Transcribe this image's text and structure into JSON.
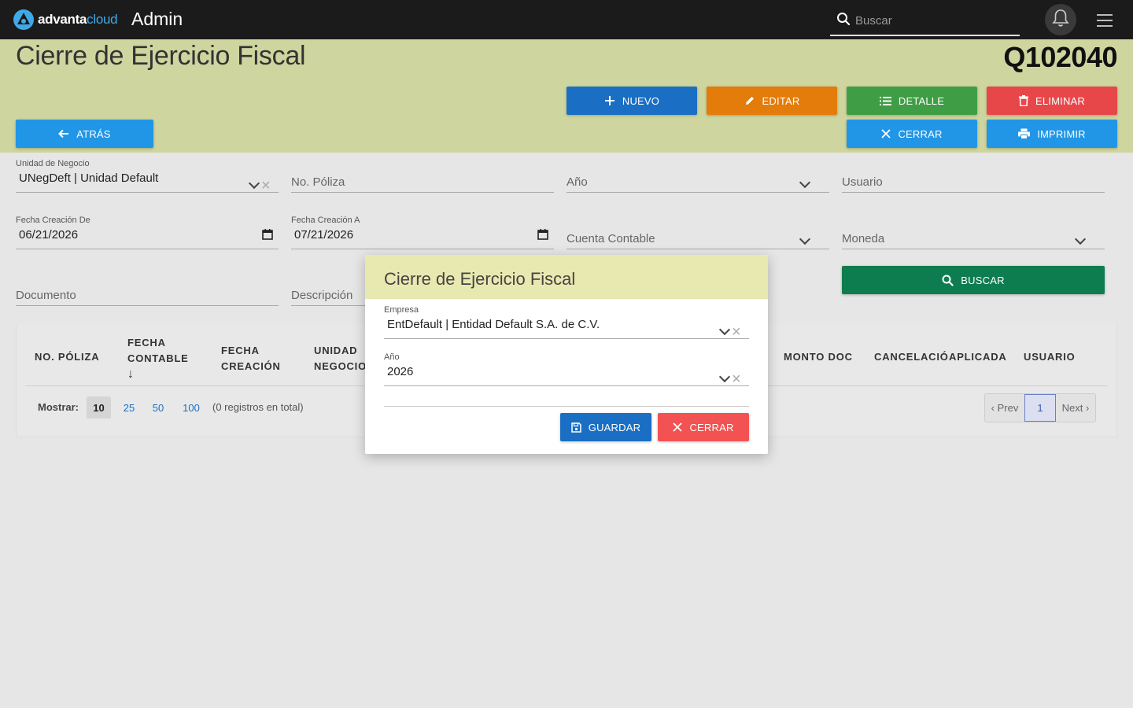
{
  "topbar": {
    "logo_brand": "advanta",
    "logo_suffix": "cloud",
    "section": "Admin",
    "search_placeholder": "Buscar",
    "icons": [
      "logo-icon",
      "search-icon",
      "bell-icon",
      "hamburger-icon"
    ]
  },
  "header": {
    "title": "Cierre de Ejercicio Fiscal",
    "code": "Q102040",
    "buttons": {
      "nuevo": "Nuevo",
      "editar": "Editar",
      "detalle": "Detalle",
      "eliminar": "Eliminar",
      "atras": "Atrás",
      "cerrar": "Cerrar",
      "imprimir": "Imprimir"
    }
  },
  "filters": {
    "unidad_label": "Unidad de Negocio",
    "unidad_value": "UNegDeft | Unidad Default",
    "poliza_placeholder": "No. Póliza",
    "anio_placeholder": "Año",
    "usuario_placeholder": "Usuario",
    "fecha_de_label": "Fecha Creación De",
    "fecha_de_value": "06/21/2026",
    "fecha_a_label": "Fecha Creación A",
    "fecha_a_value": "07/21/2026",
    "cuenta_placeholder": "Cuenta Contable",
    "moneda_placeholder": "Moneda",
    "documento_placeholder": "Documento",
    "descripcion_placeholder": "Descripción",
    "buscar_label": "Buscar"
  },
  "table": {
    "headers": {
      "poliza": "No. Póliza",
      "fecha_contable_1": "Fecha",
      "fecha_contable_2": "Contable",
      "sort_arrow": "↓",
      "fecha_creacion_1": "Fecha",
      "fecha_creacion_2": "Creación",
      "unidad_1": "Unidad",
      "unidad_2": "Negocio",
      "monto": "Monto Doc",
      "cancelacion": "Cancelació",
      "aplicada": "Aplicada",
      "usuario": "Usuario"
    },
    "mostrar_label": "Mostrar:",
    "page_sizes": [
      "10",
      "25",
      "50",
      "100"
    ],
    "selected_size": "10",
    "total_text": "(0 registros en total)",
    "pager": {
      "prev": "‹ Prev",
      "current": "1",
      "next": "Next ›"
    }
  },
  "modal": {
    "title": "Cierre de Ejercicio Fiscal",
    "empresa_label": "Empresa",
    "empresa_value": "EntDefault | Entidad Default S.A. de C.V.",
    "anio_label": "Año",
    "anio_value": "2026",
    "guardar": "Guardar",
    "cerrar": "Cerrar"
  },
  "colors": {
    "topbar": "#1b1b1b",
    "band": "#cfd59e",
    "modal_header": "#e8e9b0",
    "blue": "#1a6fc4",
    "sky": "#2196e6",
    "orange": "#e37c0a",
    "green": "#3f9e45",
    "red": "#e8474a",
    "teal": "#0d7d50"
  }
}
